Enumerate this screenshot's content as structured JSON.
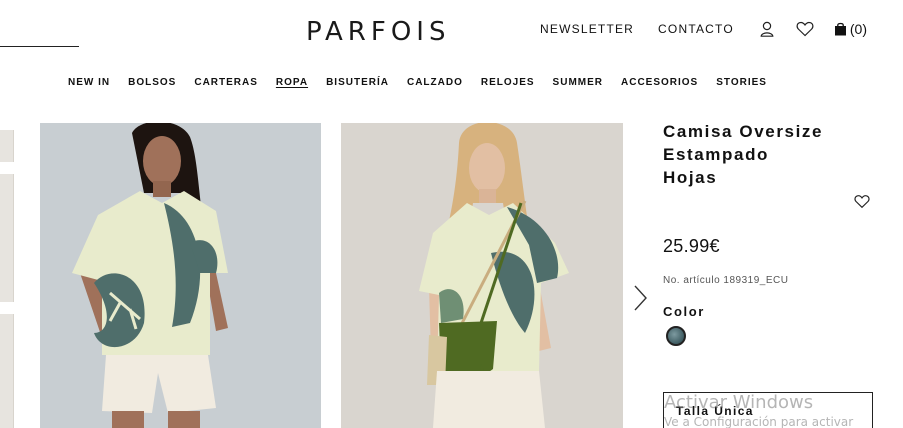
{
  "brand": {
    "logo": "PARFOIS"
  },
  "header": {
    "newsletter": "NEWSLETTER",
    "contact": "CONTACTO",
    "cart_count": "(0)"
  },
  "nav": {
    "items": [
      {
        "label": "NEW IN"
      },
      {
        "label": "BOLSOS"
      },
      {
        "label": "CARTERAS"
      },
      {
        "label": "ROPA"
      },
      {
        "label": "BISUTERÍA"
      },
      {
        "label": "CALZADO"
      },
      {
        "label": "RELOJES"
      },
      {
        "label": "SUMMER"
      },
      {
        "label": "ACCESORIOS"
      },
      {
        "label": "STORIES"
      }
    ],
    "active": "ROPA"
  },
  "product": {
    "title_line1": "Camisa Oversize",
    "title_line2": "Estampado",
    "title_line3": "Hojas",
    "price": "25.99€",
    "sku": "No. artículo 189319_ECU",
    "color_label": "Color",
    "size_label": "Talla Única"
  },
  "watermark": {
    "line1": "Activar Windows",
    "line2": "Ve a Configuración para activar"
  },
  "colors": {
    "shirt": "#e8ebcc",
    "leaf": "#4f6e6b",
    "leaf_green": "#6f8f74",
    "skin1": "#a0715a",
    "skin2": "#e2bfa3",
    "hair_dark": "#1d1410",
    "hair_blonde": "#d7b27e",
    "bag": "#4f6a22",
    "shorts": "#f1ebe0"
  },
  "icons": [
    "user-icon",
    "heart-icon",
    "bag-icon",
    "chevron-right-icon",
    "favorite-heart-icon"
  ]
}
